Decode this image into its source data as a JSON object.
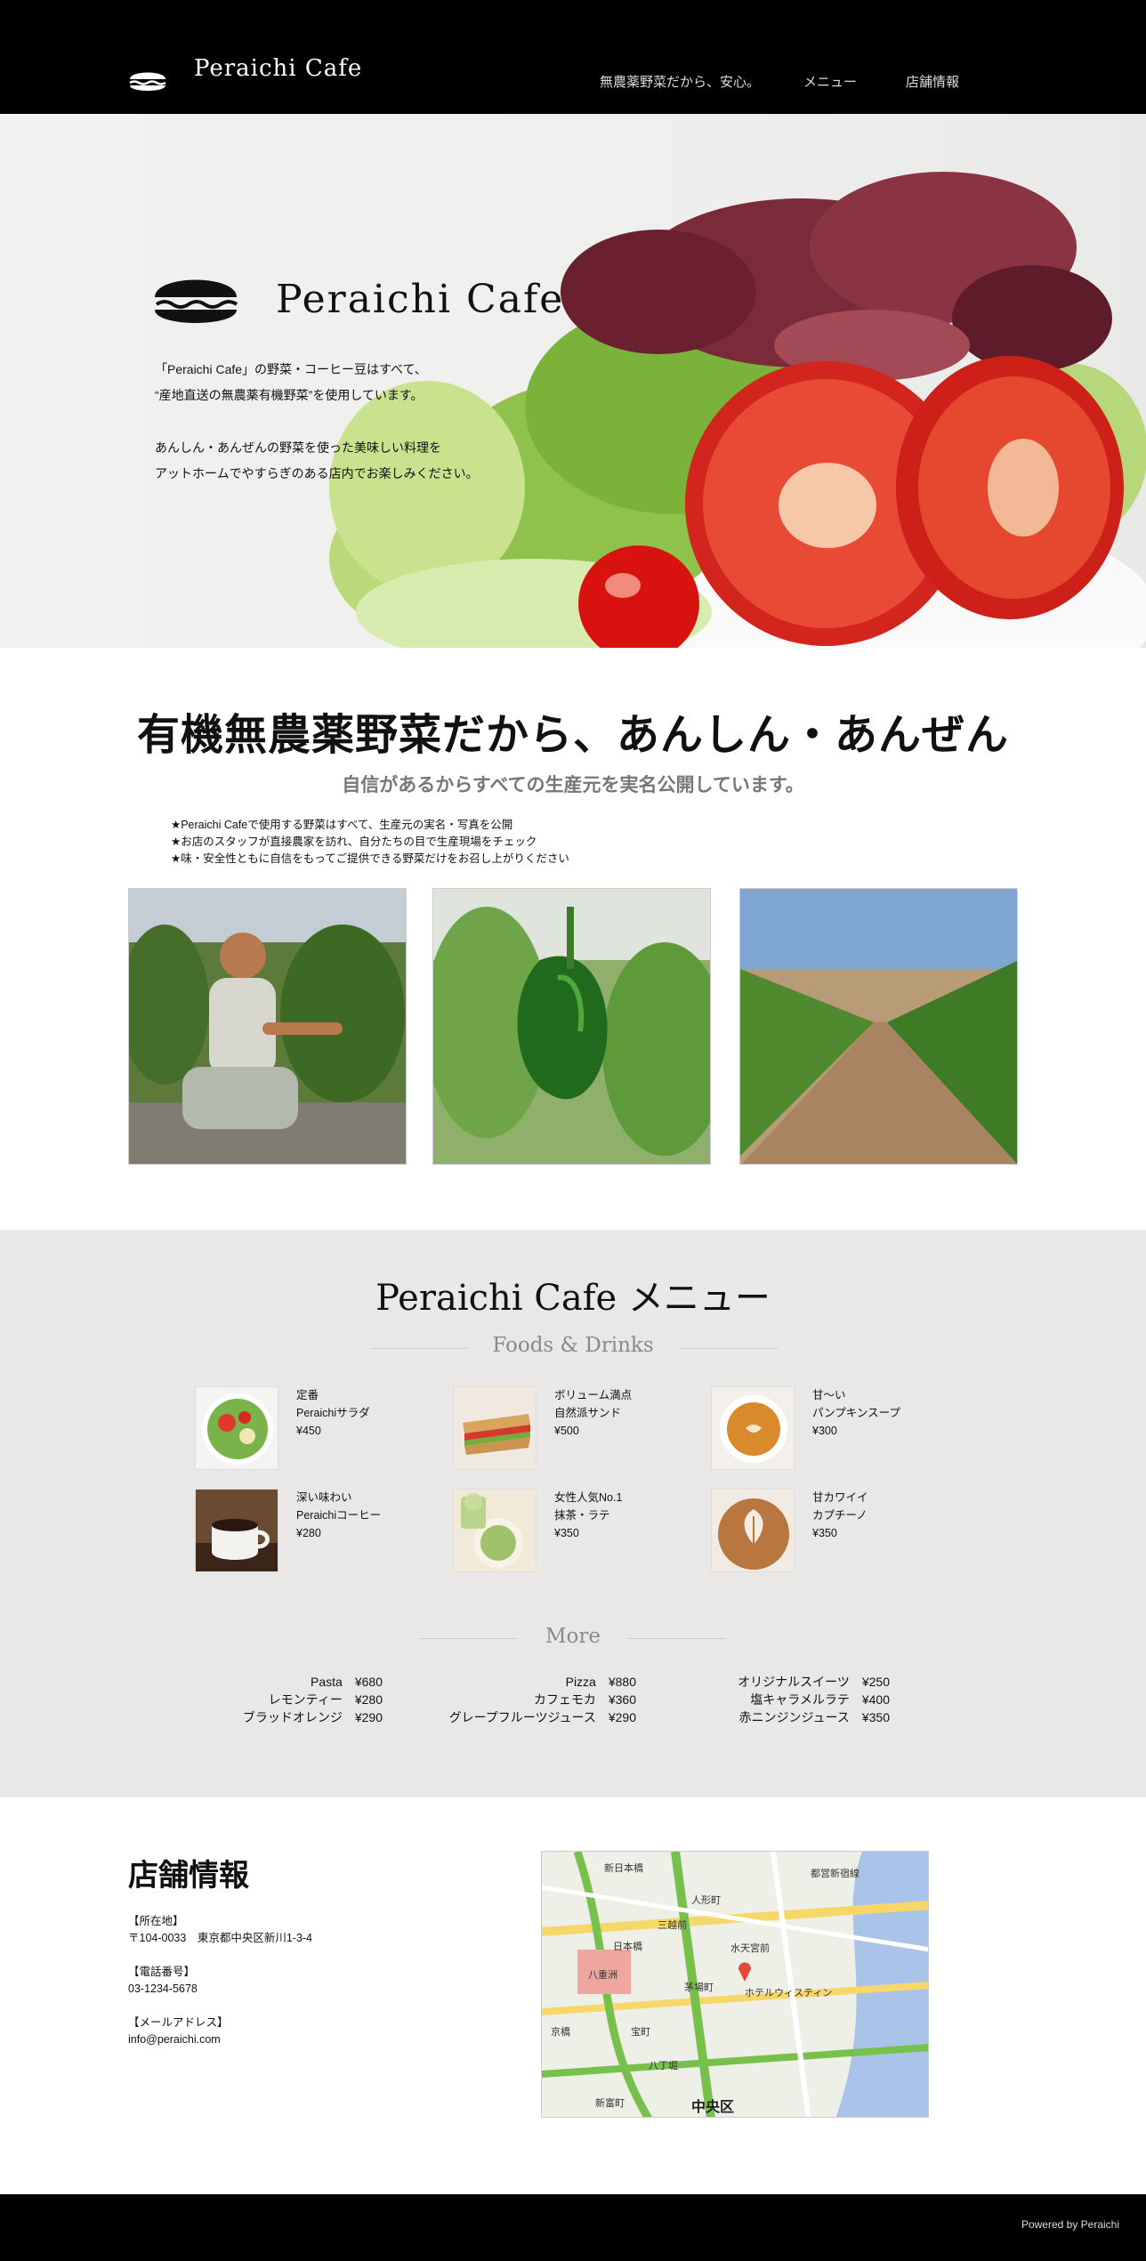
{
  "header": {
    "brand": "Peraichi Cafe",
    "nav": [
      "無農薬野菜だから、安心。",
      "メニュー",
      "店舗情報"
    ]
  },
  "hero": {
    "title": "Peraichi Cafe",
    "lines": [
      "「Peraichi Cafe」の野菜・コーヒー豆はすべて、",
      "“産地直送の無農薬有機野菜”を使用しています。",
      "あんしん・あんぜんの野菜を使った美味しい料理を",
      "アットホームでやすらぎのある店内でお楽しみください。"
    ]
  },
  "organic": {
    "title": "有機無農薬野菜だから、あんしん・あんぜん",
    "subtitle": "自信があるからすべての生産元を実名公開しています。",
    "bullets": [
      "★Peraichi Cafeで使用する野菜はすべて、生産元の実名・写真を公開",
      "★お店のスタッフが直接農家を訪れ、自分たちの目で生産現場をチェック",
      "★味・安全性ともに自信をもってご提供できる野菜だけをお召し上がりください"
    ]
  },
  "menu": {
    "title": "Peraichi Cafe メニュー",
    "subtitle": "Foods & Drinks",
    "items": [
      {
        "l1": "定番",
        "l2": "Peraichiサラダ",
        "price": "¥450"
      },
      {
        "l1": "ボリューム満点",
        "l2": "自然派サンド",
        "price": "¥500"
      },
      {
        "l1": "甘〜い",
        "l2": "パンプキンスープ",
        "price": "¥300"
      },
      {
        "l1": "深い味わい",
        "l2": "Peraichiコーヒー",
        "price": "¥280"
      },
      {
        "l1": "女性人気No.1",
        "l2": "抹茶・ラテ",
        "price": "¥350"
      },
      {
        "l1": "甘カワイイ",
        "l2": "カプチーノ",
        "price": "¥350"
      }
    ],
    "more_title": "More",
    "more": [
      [
        {
          "name": "Pasta",
          "price": "¥680"
        },
        {
          "name": "レモンティー",
          "price": "¥280"
        },
        {
          "name": "ブラッドオレンジ",
          "price": "¥290"
        }
      ],
      [
        {
          "name": "Pizza",
          "price": "¥880"
        },
        {
          "name": "カフェモカ",
          "price": "¥360"
        },
        {
          "name": "グレープフルーツジュース",
          "price": "¥290"
        }
      ],
      [
        {
          "name": "オリジナルスイーツ",
          "price": "¥250"
        },
        {
          "name": "塩キャラメルラテ",
          "price": "¥400"
        },
        {
          "name": "赤ニンジンジュース",
          "price": "¥350"
        }
      ]
    ]
  },
  "store": {
    "title": "店舗情報",
    "address_label": "【所在地】",
    "address": "〒104-0033　東京都中央区新川1-3-4",
    "phone_label": "【電話番号】",
    "phone": "03-1234-5678",
    "mail_label": "【メールアドレス】",
    "mail": "info@peraichi.com",
    "map_labels": [
      "新日本橋",
      "人形町",
      "都営新宿線",
      "三越前",
      "日本橋",
      "水天宮前",
      "八重洲",
      "茅場町",
      "京橋",
      "宝町",
      "八丁堀",
      "新富町",
      "中央区",
      "ホテルウィスティン"
    ]
  },
  "footer": {
    "text": "Powered by Peraichi"
  }
}
